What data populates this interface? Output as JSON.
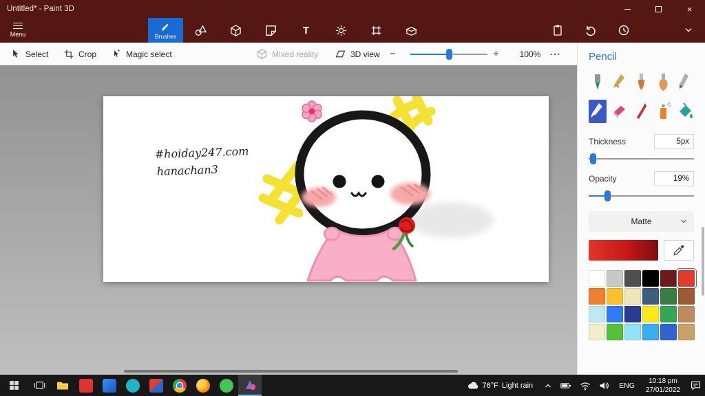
{
  "colors": {
    "titlebar": "#541713",
    "tab_accent": "#1a6ad3",
    "tile_accent": "#3c57c8",
    "panel_title": "#2d7ac2",
    "slider_accent": "#2a7ad4",
    "taskbar": "#181818",
    "canvas_dress_pink": "#f9afc7",
    "canvas_yellow": "#f3e233"
  },
  "icons": {
    "close": "×",
    "more": "⋯",
    "zoom_out": "−",
    "zoom_in": "+",
    "text_tool": "T"
  },
  "titlebar": {
    "title": "Untitled* - Paint 3D"
  },
  "menu": {
    "label": "Menu"
  },
  "toolbar": {
    "brushes_label": "Brushes",
    "tabs": [
      "brushes",
      "2d-shapes",
      "3d-shapes",
      "stickers",
      "text",
      "effects",
      "canvas",
      "3d-library"
    ]
  },
  "ribbon": {
    "select": "Select",
    "crop": "Crop",
    "magic_select": "Magic select",
    "mixed_reality": "Mixed reality",
    "view_3d": "3D view",
    "zoom": "100%"
  },
  "panel": {
    "title": "Pencil",
    "brushes": [
      "marker",
      "calligraphy-pen",
      "oil-brush",
      "watercolour",
      "pixel-pen",
      "pencil",
      "eraser",
      "crayon",
      "spray-can",
      "fill"
    ],
    "selected_brush": "pencil",
    "thickness_label": "Thickness",
    "thickness_value": "5px",
    "opacity_label": "Opacity",
    "opacity_value": "19%",
    "material_value": "Matte",
    "palette": [
      "#ffffff",
      "#c8c8c8",
      "#4f4f4f",
      "#000000",
      "#6e191c",
      "#e23b2e",
      "#f08030",
      "#fcc12c",
      "#efe6b7",
      "#3f5e7d",
      "#3a7d44",
      "#9a5b35",
      "#bfe8f2",
      "#2f7bf5",
      "#2b3a92",
      "#ffe81a",
      "#33a758",
      "#bf8a5d",
      "#f1eecb",
      "#54c13a",
      "#90e2f5",
      "#3aaef2",
      "#2f63d0",
      "#caa06b"
    ],
    "selected_color_index": 5,
    "selected_color": "#e23b2e"
  },
  "canvas": {
    "caption_line1": "#hoiday247.com",
    "caption_line2": "hanachan3"
  },
  "taskbar": {
    "weather_temp": "76°F",
    "weather_desc": "Light rain",
    "language": "ENG",
    "time": "10:18 pm",
    "date": "27/01/2022"
  }
}
